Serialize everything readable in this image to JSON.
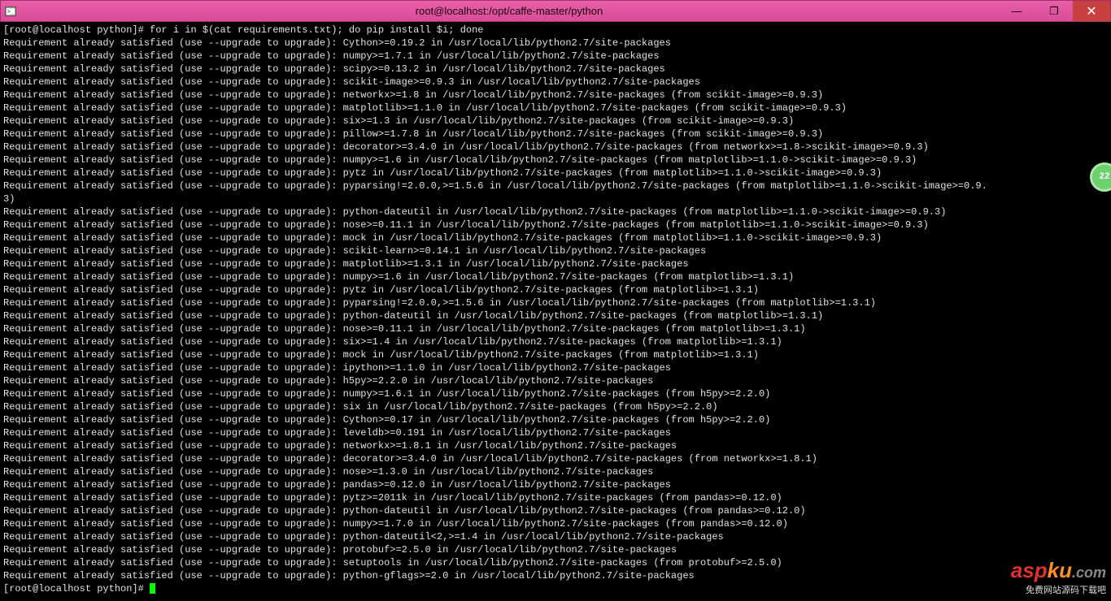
{
  "window": {
    "title": "root@localhost:/opt/caffe-master/python",
    "min_label": "—",
    "max_label": "❐",
    "close_label": "✕"
  },
  "badge": {
    "count": "22"
  },
  "watermark": {
    "big1": "a",
    "big2": "sp",
    "big3": "ku",
    "big4": ".com",
    "sub": "免费网站源码下载吧"
  },
  "prompt1": "[root@localhost python]# ",
  "cmd1": "for i in $(cat requirements.txt); do pip install $i; done",
  "prompt2": "[root@localhost python]# ",
  "lines": [
    "Requirement already satisfied (use --upgrade to upgrade): Cython>=0.19.2 in /usr/local/lib/python2.7/site-packages",
    "Requirement already satisfied (use --upgrade to upgrade): numpy>=1.7.1 in /usr/local/lib/python2.7/site-packages",
    "Requirement already satisfied (use --upgrade to upgrade): scipy>=0.13.2 in /usr/local/lib/python2.7/site-packages",
    "Requirement already satisfied (use --upgrade to upgrade): scikit-image>=0.9.3 in /usr/local/lib/python2.7/site-packages",
    "Requirement already satisfied (use --upgrade to upgrade): networkx>=1.8 in /usr/local/lib/python2.7/site-packages (from scikit-image>=0.9.3)",
    "Requirement already satisfied (use --upgrade to upgrade): matplotlib>=1.1.0 in /usr/local/lib/python2.7/site-packages (from scikit-image>=0.9.3)",
    "Requirement already satisfied (use --upgrade to upgrade): six>=1.3 in /usr/local/lib/python2.7/site-packages (from scikit-image>=0.9.3)",
    "Requirement already satisfied (use --upgrade to upgrade): pillow>=1.7.8 in /usr/local/lib/python2.7/site-packages (from scikit-image>=0.9.3)",
    "Requirement already satisfied (use --upgrade to upgrade): decorator>=3.4.0 in /usr/local/lib/python2.7/site-packages (from networkx>=1.8->scikit-image>=0.9.3)",
    "Requirement already satisfied (use --upgrade to upgrade): numpy>=1.6 in /usr/local/lib/python2.7/site-packages (from matplotlib>=1.1.0->scikit-image>=0.9.3)",
    "Requirement already satisfied (use --upgrade to upgrade): pytz in /usr/local/lib/python2.7/site-packages (from matplotlib>=1.1.0->scikit-image>=0.9.3)",
    "Requirement already satisfied (use --upgrade to upgrade): pyparsing!=2.0.0,>=1.5.6 in /usr/local/lib/python2.7/site-packages (from matplotlib>=1.1.0->scikit-image>=0.9.",
    "3)",
    "Requirement already satisfied (use --upgrade to upgrade): python-dateutil in /usr/local/lib/python2.7/site-packages (from matplotlib>=1.1.0->scikit-image>=0.9.3)",
    "Requirement already satisfied (use --upgrade to upgrade): nose>=0.11.1 in /usr/local/lib/python2.7/site-packages (from matplotlib>=1.1.0->scikit-image>=0.9.3)",
    "Requirement already satisfied (use --upgrade to upgrade): mock in /usr/local/lib/python2.7/site-packages (from matplotlib>=1.1.0->scikit-image>=0.9.3)",
    "Requirement already satisfied (use --upgrade to upgrade): scikit-learn>=0.14.1 in /usr/local/lib/python2.7/site-packages",
    "Requirement already satisfied (use --upgrade to upgrade): matplotlib>=1.3.1 in /usr/local/lib/python2.7/site-packages",
    "Requirement already satisfied (use --upgrade to upgrade): numpy>=1.6 in /usr/local/lib/python2.7/site-packages (from matplotlib>=1.3.1)",
    "Requirement already satisfied (use --upgrade to upgrade): pytz in /usr/local/lib/python2.7/site-packages (from matplotlib>=1.3.1)",
    "Requirement already satisfied (use --upgrade to upgrade): pyparsing!=2.0.0,>=1.5.6 in /usr/local/lib/python2.7/site-packages (from matplotlib>=1.3.1)",
    "Requirement already satisfied (use --upgrade to upgrade): python-dateutil in /usr/local/lib/python2.7/site-packages (from matplotlib>=1.3.1)",
    "Requirement already satisfied (use --upgrade to upgrade): nose>=0.11.1 in /usr/local/lib/python2.7/site-packages (from matplotlib>=1.3.1)",
    "Requirement already satisfied (use --upgrade to upgrade): six>=1.4 in /usr/local/lib/python2.7/site-packages (from matplotlib>=1.3.1)",
    "Requirement already satisfied (use --upgrade to upgrade): mock in /usr/local/lib/python2.7/site-packages (from matplotlib>=1.3.1)",
    "Requirement already satisfied (use --upgrade to upgrade): ipython>=1.1.0 in /usr/local/lib/python2.7/site-packages",
    "Requirement already satisfied (use --upgrade to upgrade): h5py>=2.2.0 in /usr/local/lib/python2.7/site-packages",
    "Requirement already satisfied (use --upgrade to upgrade): numpy>=1.6.1 in /usr/local/lib/python2.7/site-packages (from h5py>=2.2.0)",
    "Requirement already satisfied (use --upgrade to upgrade): six in /usr/local/lib/python2.7/site-packages (from h5py>=2.2.0)",
    "Requirement already satisfied (use --upgrade to upgrade): Cython>=0.17 in /usr/local/lib/python2.7/site-packages (from h5py>=2.2.0)",
    "Requirement already satisfied (use --upgrade to upgrade): leveldb>=0.191 in /usr/local/lib/python2.7/site-packages",
    "Requirement already satisfied (use --upgrade to upgrade): networkx>=1.8.1 in /usr/local/lib/python2.7/site-packages",
    "Requirement already satisfied (use --upgrade to upgrade): decorator>=3.4.0 in /usr/local/lib/python2.7/site-packages (from networkx>=1.8.1)",
    "Requirement already satisfied (use --upgrade to upgrade): nose>=1.3.0 in /usr/local/lib/python2.7/site-packages",
    "Requirement already satisfied (use --upgrade to upgrade): pandas>=0.12.0 in /usr/local/lib/python2.7/site-packages",
    "Requirement already satisfied (use --upgrade to upgrade): pytz>=2011k in /usr/local/lib/python2.7/site-packages (from pandas>=0.12.0)",
    "Requirement already satisfied (use --upgrade to upgrade): python-dateutil in /usr/local/lib/python2.7/site-packages (from pandas>=0.12.0)",
    "Requirement already satisfied (use --upgrade to upgrade): numpy>=1.7.0 in /usr/local/lib/python2.7/site-packages (from pandas>=0.12.0)",
    "Requirement already satisfied (use --upgrade to upgrade): python-dateutil<2,>=1.4 in /usr/local/lib/python2.7/site-packages",
    "Requirement already satisfied (use --upgrade to upgrade): protobuf>=2.5.0 in /usr/local/lib/python2.7/site-packages",
    "Requirement already satisfied (use --upgrade to upgrade): setuptools in /usr/local/lib/python2.7/site-packages (from protobuf>=2.5.0)",
    "Requirement already satisfied (use --upgrade to upgrade): python-gflags>=2.0 in /usr/local/lib/python2.7/site-packages"
  ]
}
